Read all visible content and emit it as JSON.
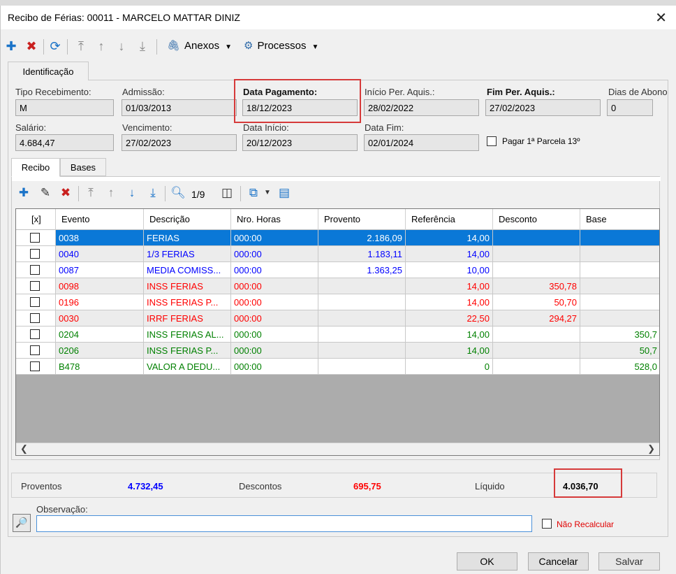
{
  "window": {
    "title": "Recibo de Férias: 00011 - MARCELO MATTAR DINIZ"
  },
  "toolbar": {
    "anexos_label": "Anexos",
    "processos_label": "Processos",
    "icons": [
      "plus-icon",
      "delete-icon",
      "refresh-icon",
      "first-icon",
      "up-icon",
      "down-icon",
      "last-icon",
      "paperclip-icon",
      "gear-icon"
    ]
  },
  "tabs": {
    "identificacao": "Identificação",
    "recibo": "Recibo",
    "bases": "Bases"
  },
  "fields": {
    "tipo_recebimento": {
      "label": "Tipo Recebimento:",
      "value": "M"
    },
    "admissao": {
      "label": "Admissão:",
      "value": "01/03/2013"
    },
    "data_pagamento": {
      "label": "Data Pagamento:",
      "value": "18/12/2023"
    },
    "inicio_per_aquis": {
      "label": "Início Per. Aquis.:",
      "value": "28/02/2022"
    },
    "fim_per_aquis": {
      "label": "Fim Per. Aquis.:",
      "value": "27/02/2023"
    },
    "dias_abono": {
      "label": "Dias de Abono",
      "value": "0"
    },
    "salario": {
      "label": "Salário:",
      "value": "4.684,47"
    },
    "vencimento": {
      "label": "Vencimento:",
      "value": "27/02/2023"
    },
    "data_inicio": {
      "label": "Data Início:",
      "value": "20/12/2023"
    },
    "data_fim": {
      "label": "Data Fim:",
      "value": "02/01/2024"
    },
    "pagar_parcela": {
      "label": "Pagar 1ª Parcela 13º",
      "checked": false
    }
  },
  "grid_toolbar": {
    "page": "1/9"
  },
  "grid": {
    "columns": [
      "[x]",
      "Evento",
      "Descrição",
      "Nro. Horas",
      "Provento",
      "Referência",
      "Desconto",
      "Base"
    ],
    "rows": [
      {
        "evento": "0038",
        "descricao": "FERIAS",
        "horas": "000:00",
        "provento": "2.186,09",
        "referencia": "14,00",
        "desconto": "",
        "base": "",
        "color": "#0000ff",
        "selected": true
      },
      {
        "evento": "0040",
        "descricao": "1/3 FERIAS",
        "horas": "000:00",
        "provento": "1.183,11",
        "referencia": "14,00",
        "desconto": "",
        "base": "",
        "color": "#0000ff",
        "selected": false
      },
      {
        "evento": "0087",
        "descricao": "MEDIA COMISS...",
        "horas": "000:00",
        "provento": "1.363,25",
        "referencia": "10,00",
        "desconto": "",
        "base": "",
        "color": "#0000ff",
        "selected": false
      },
      {
        "evento": "0098",
        "descricao": "INSS FERIAS",
        "horas": "000:00",
        "provento": "",
        "referencia": "14,00",
        "desconto": "350,78",
        "base": "",
        "color": "#ff0000",
        "selected": false
      },
      {
        "evento": "0196",
        "descricao": "INSS FERIAS P...",
        "horas": "000:00",
        "provento": "",
        "referencia": "14,00",
        "desconto": "50,70",
        "base": "",
        "color": "#ff0000",
        "selected": false
      },
      {
        "evento": "0030",
        "descricao": "IRRF FERIAS",
        "horas": "000:00",
        "provento": "",
        "referencia": "22,50",
        "desconto": "294,27",
        "base": "",
        "color": "#ff0000",
        "selected": false
      },
      {
        "evento": "0204",
        "descricao": "INSS FERIAS AL...",
        "horas": "000:00",
        "provento": "",
        "referencia": "14,00",
        "desconto": "",
        "base": "350,7",
        "color": "#008000",
        "selected": false
      },
      {
        "evento": "0206",
        "descricao": "INSS FERIAS P...",
        "horas": "000:00",
        "provento": "",
        "referencia": "14,00",
        "desconto": "",
        "base": "50,7",
        "color": "#008000",
        "selected": false
      },
      {
        "evento": "B478",
        "descricao": "VALOR A DEDU...",
        "horas": "000:00",
        "provento": "",
        "referencia": "0",
        "desconto": "",
        "base": "528,0",
        "color": "#008000",
        "selected": false
      }
    ]
  },
  "totals": {
    "proventos_label": "Proventos",
    "proventos_value": "4.732,45",
    "descontos_label": "Descontos",
    "descontos_value": "695,75",
    "liquido_label": "Líquido",
    "liquido_value": "4.036,70"
  },
  "observacao": {
    "label": "Observação:",
    "value": ""
  },
  "nao_recalcular": {
    "label": "Não Recalcular",
    "checked": false
  },
  "buttons": {
    "ok": "OK",
    "cancelar": "Cancelar",
    "salvar": "Salvar"
  },
  "colors": {
    "selection": "#0a78d7",
    "blue_text": "#0000ff",
    "red_text": "#ff0000",
    "green_text": "#008000",
    "highlight_box": "#d63a3a"
  }
}
